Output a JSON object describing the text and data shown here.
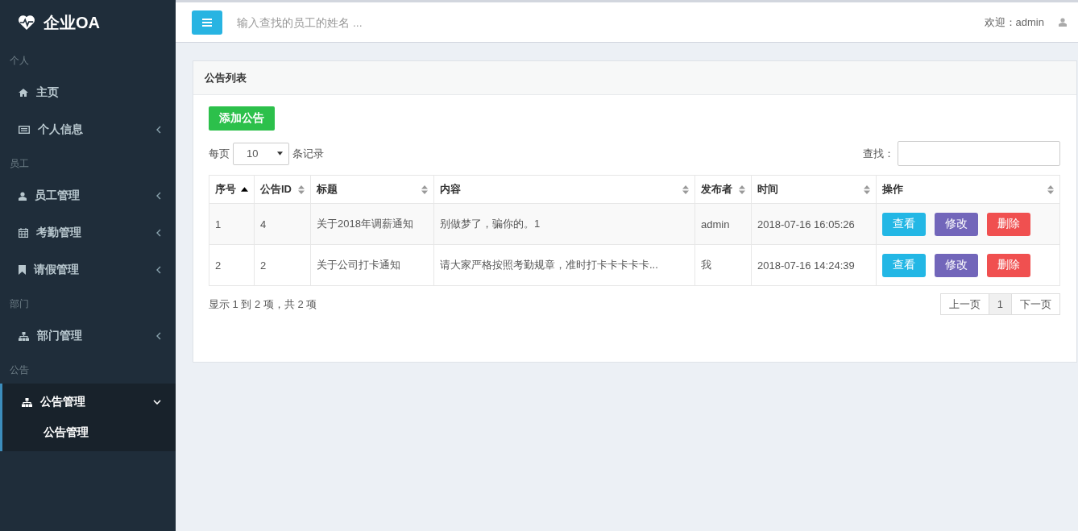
{
  "sidebar": {
    "brand": "企业OA",
    "sections": [
      {
        "title": "个人",
        "items": [
          {
            "label": "主页",
            "selected": false
          },
          {
            "label": "个人信息",
            "expanded": false,
            "selected": false
          }
        ]
      },
      {
        "title": "员工",
        "items": [
          {
            "label": "员工管理",
            "expanded": false,
            "selected": false
          },
          {
            "label": "考勤管理",
            "expanded": false,
            "selected": false
          },
          {
            "label": "请假管理",
            "expanded": false,
            "selected": false
          }
        ]
      },
      {
        "title": "部门",
        "items": [
          {
            "label": "部门管理",
            "expanded": false,
            "selected": false
          }
        ]
      },
      {
        "title": "公告",
        "items": [
          {
            "label": "公告管理",
            "expanded": true,
            "selected": true,
            "children": [
              {
                "label": "公告管理",
                "selected": true
              }
            ]
          }
        ]
      }
    ]
  },
  "topbar": {
    "search_placeholder": "输入查找的员工的姓名 ...",
    "welcome": "欢迎：admin"
  },
  "panel": {
    "title": "公告列表",
    "add_button": "添加公告",
    "page_size_prefix": "每页",
    "page_size": "10",
    "page_size_suffix": "条记录",
    "search_label": "查找：",
    "columns": [
      {
        "label": "序号",
        "sorted": true
      },
      {
        "label": "公告ID",
        "sorted": false
      },
      {
        "label": "标题",
        "sorted": false
      },
      {
        "label": "内容",
        "sorted": false
      },
      {
        "label": "发布者",
        "sorted": false
      },
      {
        "label": "时间",
        "sorted": false
      },
      {
        "label": "操作",
        "sorted": false
      }
    ],
    "rows": [
      {
        "cells": [
          "1",
          "4",
          "关于2018年调薪通知",
          "别做梦了，骗你的。1",
          "admin",
          "2018-07-16 16:05:26"
        ],
        "actions": [
          {
            "label": "查看",
            "kind": "view"
          },
          {
            "label": "修改",
            "kind": "edit"
          },
          {
            "label": "删除",
            "kind": "delete"
          }
        ]
      },
      {
        "cells": [
          "2",
          "2",
          "关于公司打卡通知",
          "请大家严格按照考勤规章，准时打卡卡卡卡卡...",
          "我",
          "2018-07-16 14:24:39"
        ],
        "actions": [
          {
            "label": "查看",
            "kind": "view"
          },
          {
            "label": "修改",
            "kind": "edit"
          },
          {
            "label": "删除",
            "kind": "delete"
          }
        ]
      }
    ],
    "info": "显示 1 到 2 项，共 2 项",
    "pagination": [
      {
        "label": "上一页",
        "selected": false
      },
      {
        "label": "1",
        "selected": true
      },
      {
        "label": "下一页",
        "selected": false
      }
    ]
  }
}
